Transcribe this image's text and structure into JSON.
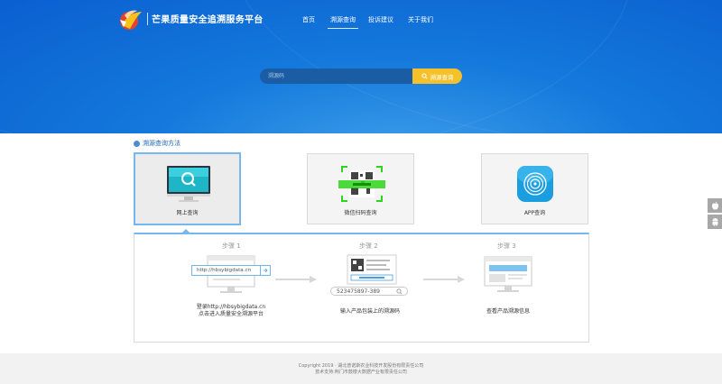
{
  "header": {
    "site_title": "芒果质量安全追溯服务平台",
    "nav": [
      "首页",
      "溯源查询",
      "投诉建议",
      "关于我们"
    ],
    "active_nav": "溯源查询"
  },
  "search": {
    "placeholder": "溯源码",
    "button_label": "溯源查询",
    "button_icon": "search-icon"
  },
  "methods": {
    "section_title": "溯源查询方法",
    "items": [
      {
        "label": "网上查询",
        "icon": "monitor-search-icon",
        "active": true
      },
      {
        "label": "微信扫码查询",
        "icon": "qr-scan-icon",
        "active": false
      },
      {
        "label": "APP查询",
        "icon": "fingerprint-app-icon",
        "active": false
      }
    ]
  },
  "steps": {
    "items": [
      {
        "title": "步骤 1",
        "url_text": "http://hbsybigdata.cn",
        "desc_line1": "登录http://hbsybigdata.cn",
        "desc_line2": "点击进入质量安全溯源平台"
      },
      {
        "title": "步骤 2",
        "code_text": "523475897-389",
        "desc_line1": "输入产品包装上的溯源码"
      },
      {
        "title": "步骤 3",
        "desc_line1": "查看产品溯源信息"
      }
    ]
  },
  "footer": {
    "line1": "Copyright 2019 · 湖北普诺斯农业科技开发股份有限责任公司",
    "line2": "技术支持:荆门市鼓楼大数据产业有限责任公司"
  },
  "sidebar": {
    "buttons": [
      {
        "icon": "apple-icon"
      },
      {
        "icon": "android-icon"
      }
    ]
  },
  "colors": {
    "hero_blue": "#1479dc",
    "accent_yellow": "#f4c12b",
    "highlight_blue": "#76b8ee",
    "qr_green": "#2bd61a"
  }
}
